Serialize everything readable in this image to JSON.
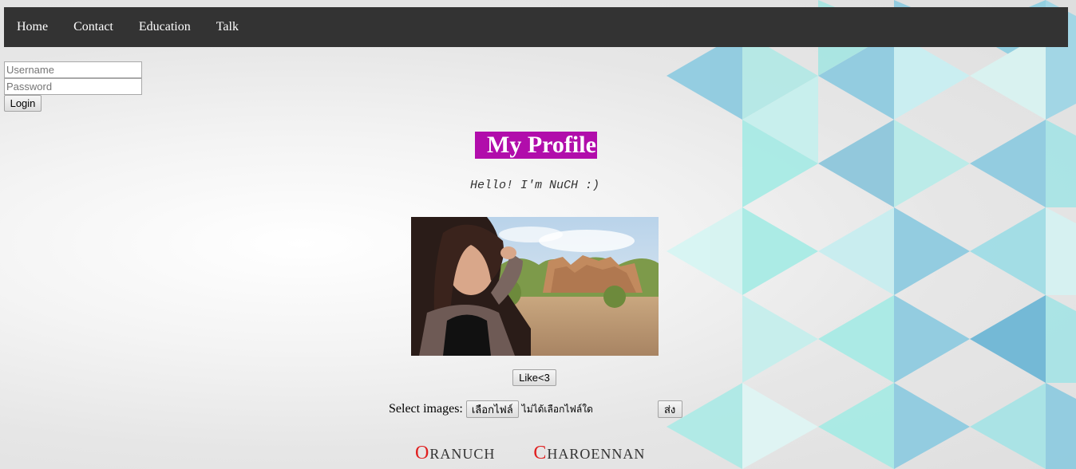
{
  "nav": {
    "items": [
      {
        "label": "Home"
      },
      {
        "label": "Contact"
      },
      {
        "label": "Education"
      },
      {
        "label": "Talk"
      }
    ]
  },
  "login": {
    "username_placeholder": "Username",
    "password_placeholder": "Password",
    "button_label": "Login"
  },
  "profile": {
    "title": "My Profile",
    "greeting": "Hello! I'm NuCH :)",
    "like_label": "Like<3",
    "upload": {
      "label": "Select images:",
      "file_button": "เลือกไฟล์",
      "file_status": "ไม่ได้เลือกไฟล์ใด",
      "submit_label": "ส่ง"
    },
    "name": {
      "first_initial": "O",
      "first_rest": "ranuch",
      "last_initial": "C",
      "last_rest": "haroennan"
    }
  },
  "colors": {
    "navbar_bg": "#333333",
    "title_bg": "#b10dab",
    "name_initial": "#e02020"
  }
}
